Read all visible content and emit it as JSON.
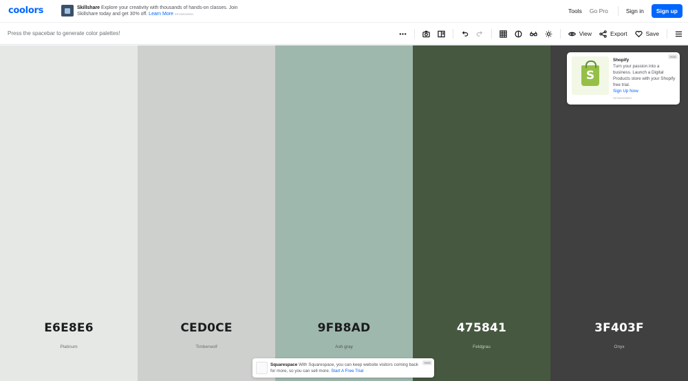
{
  "brand": {
    "logo": "coolors"
  },
  "promo": {
    "icon": "skillshare-logo",
    "title": "Skillshare",
    "text": "Explore your creativity with thousands of hands-on classes. Join Skillshare today and get 30% off.",
    "link": "Learn More",
    "sponsored": "SPONSORED"
  },
  "nav": {
    "tools": "Tools",
    "go_pro": "Go Pro",
    "sign_in": "Sign in",
    "sign_up": "Sign up"
  },
  "toolbar": {
    "hint": "Press the spacebar to generate color palettes!",
    "view": "View",
    "export": "Export",
    "save": "Save",
    "icons": [
      "more-icon",
      "camera-icon",
      "layout-icon",
      "undo-icon",
      "redo-icon",
      "grid-icon",
      "contrast-icon",
      "glasses-icon",
      "sun-icon",
      "eye-icon",
      "share-icon",
      "heart-icon",
      "menu-icon"
    ]
  },
  "palette": [
    {
      "hex": "E6E8E6",
      "name": "Platinum",
      "color": "#E6E8E6",
      "text_color": "#1b1c1e",
      "name_color": "#6d6f74"
    },
    {
      "hex": "CED0CE",
      "name": "Timberwolf",
      "color": "#CED0CE",
      "text_color": "#1b1c1e",
      "name_color": "#6d6f74"
    },
    {
      "hex": "9FB8AD",
      "name": "Ash gray",
      "color": "#9FB8AD",
      "text_color": "#1b1c1e",
      "name_color": "#4a5550"
    },
    {
      "hex": "475841",
      "name": "Feldgrau",
      "color": "#475841",
      "text_color": "#ffffff",
      "name_color": "#c4ccc1"
    },
    {
      "hex": "3F403F",
      "name": "Onyx",
      "color": "#3F403F",
      "text_color": "#ffffff",
      "name_color": "#c3c4c3"
    }
  ],
  "ads": {
    "shopify": {
      "title": "Shopify",
      "text": "Turn your passion into a business. Launch a Digital Products store with your Shopify free trial.",
      "cta": "Sign Up Now",
      "sponsored": "SPONSORED",
      "hide": "HIDE"
    },
    "squarespace": {
      "title": "Squarespace",
      "text": "With Squarespace, you can keep website visitors coming back for more, so you can sell more.",
      "cta": "Start A Free Trial",
      "hide": "HIDE"
    }
  }
}
